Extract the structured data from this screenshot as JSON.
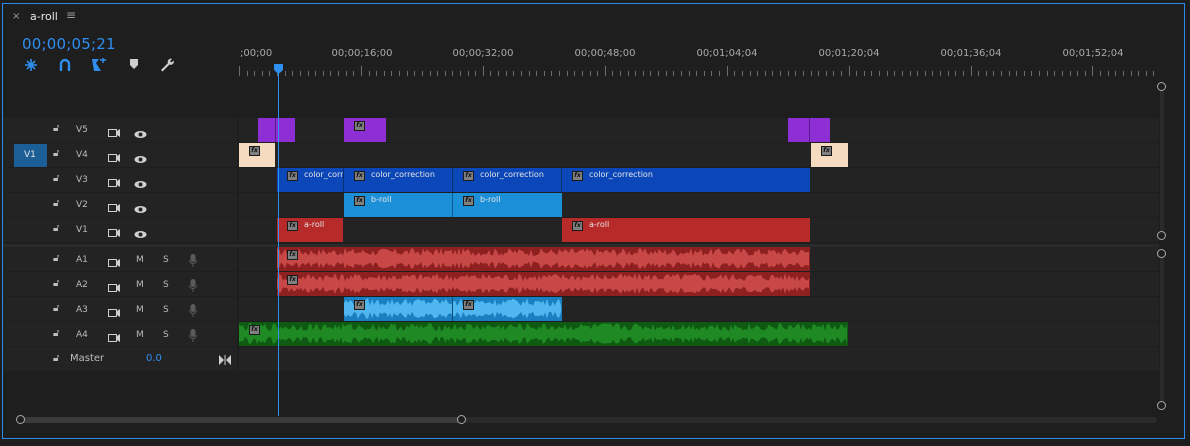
{
  "sequence_tab": {
    "close_glyph": "×",
    "title": "a-roll",
    "menu_glyph": "≡"
  },
  "timecode": "00;00;05;21",
  "toolbar": [
    {
      "name": "snap-icon",
      "glyph": "⁜"
    },
    {
      "name": "linked-selection-icon",
      "glyph": "∩"
    },
    {
      "name": "add-marker-icon",
      "glyph": "⬧"
    },
    {
      "name": "marker-icon",
      "glyph": "⬟"
    },
    {
      "name": "wrench-icon",
      "glyph": "🔧"
    }
  ],
  "ruler_labels": [
    ";00;00",
    "00;00;16;00",
    "00;00;32;00",
    "00;00;48;00",
    "00;01;04;04",
    "00;01;20;04",
    "00;01;36;04",
    "00;01;52;04"
  ],
  "video_tracks": [
    {
      "name": "V5",
      "target": ""
    },
    {
      "name": "V4",
      "target": "V1"
    },
    {
      "name": "V3",
      "target": ""
    },
    {
      "name": "V2",
      "target": ""
    },
    {
      "name": "V1",
      "target": ""
    }
  ],
  "audio_tracks": [
    {
      "name": "A1",
      "m": "M",
      "s": "S"
    },
    {
      "name": "A2",
      "m": "M",
      "s": "S"
    },
    {
      "name": "A3",
      "m": "M",
      "s": "S"
    },
    {
      "name": "A4",
      "m": "M",
      "s": "S"
    }
  ],
  "master": {
    "label": "Master",
    "value": "0.0"
  },
  "clips": {
    "color_correction_1": "color_corr",
    "color_correction_2": "color_correction",
    "color_correction_3": "color_correction",
    "color_correction_4": "color_correction",
    "b_roll_1": "b-roll",
    "b_roll_2": "b-roll",
    "a_roll_1": "a-roll",
    "a_roll_2": "a-roll",
    "fx": "fx"
  },
  "colors": {
    "accent": "#2f8ff0",
    "adjustment": "#8e2fd6",
    "title": "#f5dcc0",
    "color_correction": "#0b47b8",
    "b_roll": "#1b8fd8",
    "a_roll": "#b62a2a",
    "audio_a1": "#8e2020",
    "audio_a3": "#1a7fc0",
    "audio_a4": "#0f5a12"
  }
}
